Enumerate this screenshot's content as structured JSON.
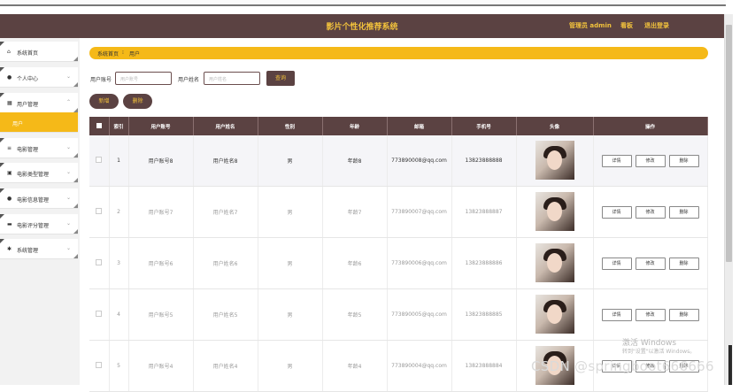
{
  "header": {
    "title": "影片个性化推荐系统",
    "admin": "管理员 admin",
    "board": "看板",
    "logout": "退出登录"
  },
  "sidebar": {
    "items": [
      {
        "icon": "home-icon",
        "glyph": "⌂",
        "label": "系统首页"
      },
      {
        "icon": "user-icon",
        "glyph": "●",
        "label": "个人中心"
      },
      {
        "icon": "grid-icon",
        "glyph": "▦",
        "label": "用户管理"
      },
      {
        "icon": "",
        "glyph": "",
        "label": "用户"
      },
      {
        "icon": "list-icon",
        "glyph": "≡",
        "label": "电影管理"
      },
      {
        "icon": "folder-icon",
        "glyph": "▣",
        "label": "电影类型管理"
      },
      {
        "icon": "user-icon",
        "glyph": "●",
        "label": "电影信息管理"
      },
      {
        "icon": "monitor-icon",
        "glyph": "▬",
        "label": "电影评分管理"
      },
      {
        "icon": "gear-icon",
        "glyph": "✱",
        "label": "系统管理"
      }
    ]
  },
  "breadcrumb": {
    "home": "系统首页",
    "sep": "⁝",
    "current": "用户"
  },
  "search": {
    "account_label": "用户账号",
    "account_placeholder": "用户账号",
    "name_label": "用户姓名",
    "name_placeholder": "用户姓名",
    "query_btn": "查询"
  },
  "actions": {
    "add": "新增",
    "delete": "删除"
  },
  "table": {
    "headers": [
      "索引",
      "用户账号",
      "用户姓名",
      "性别",
      "年龄",
      "邮箱",
      "手机号",
      "头像",
      "操作"
    ],
    "row_buttons": [
      "详情",
      "修改",
      "删除"
    ],
    "rows": [
      {
        "index": "1",
        "account": "用户账号8",
        "name": "用户姓名8",
        "gender": "男",
        "age": "年龄8",
        "email": "773890008@qq.com",
        "phone": "13823888888"
      },
      {
        "index": "2",
        "account": "用户账号7",
        "name": "用户姓名7",
        "gender": "男",
        "age": "年龄7",
        "email": "773890007@qq.com",
        "phone": "13823888887"
      },
      {
        "index": "3",
        "account": "用户账号6",
        "name": "用户姓名6",
        "gender": "男",
        "age": "年龄6",
        "email": "773890006@qq.com",
        "phone": "13823888886"
      },
      {
        "index": "4",
        "account": "用户账号5",
        "name": "用户姓名5",
        "gender": "男",
        "age": "年龄5",
        "email": "773890005@qq.com",
        "phone": "13823888885"
      },
      {
        "index": "5",
        "account": "用户账号4",
        "name": "用户姓名4",
        "gender": "男",
        "age": "年龄4",
        "email": "773890004@qq.com",
        "phone": "13823888884"
      }
    ]
  },
  "watermark": {
    "line1": "激活 Windows",
    "line2": "转到\"设置\"以激活 Windows。",
    "csdn": "CSDN @springboot666666"
  },
  "colors": {
    "header": "#5b4242",
    "accent": "#f5b918",
    "title": "#f2c23c"
  }
}
